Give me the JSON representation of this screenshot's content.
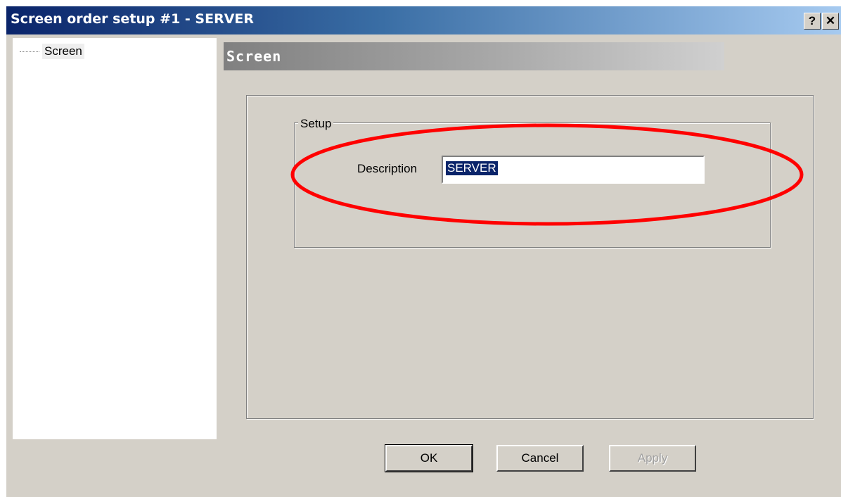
{
  "window": {
    "title": "Screen order setup #1 - SERVER",
    "help_glyph": "?",
    "close_glyph": "✕"
  },
  "tree": {
    "items": [
      {
        "label": "Screen"
      }
    ]
  },
  "section": {
    "header": "Screen"
  },
  "setup": {
    "group_label": "Setup",
    "description_label": "Description",
    "description_value": "SERVER"
  },
  "buttons": {
    "ok": "OK",
    "cancel": "Cancel",
    "apply": "Apply"
  },
  "colors": {
    "annotation": "#ff0000",
    "title_bar": "#0a246a",
    "face": "#d4d0c8"
  }
}
